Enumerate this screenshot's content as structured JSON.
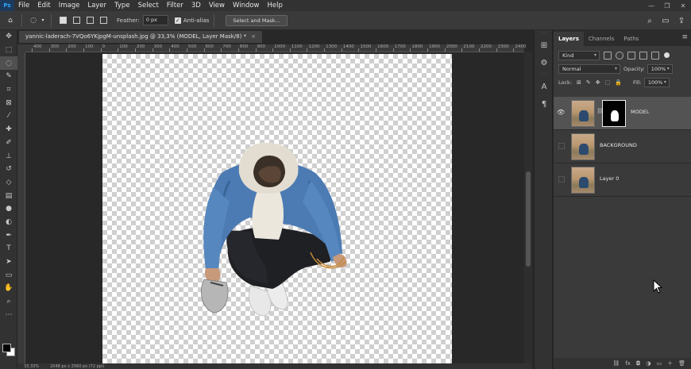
{
  "menubar": {
    "logo": "Ps",
    "items": [
      "File",
      "Edit",
      "Image",
      "Layer",
      "Type",
      "Select",
      "Filter",
      "3D",
      "View",
      "Window",
      "Help"
    ],
    "controls": [
      "—",
      "❐",
      "✕"
    ]
  },
  "options": {
    "feather_label": "Feather:",
    "feather_value": "0 px",
    "antialias_label": "Anti-alias",
    "select_mask_button": "Select and Mask..."
  },
  "document": {
    "tab_title": "yannic-laderach-7VQo6YKjpgM-unsplash.jpg @ 33,3% (MODEL, Layer Mask/8) *",
    "tab_close": "×",
    "ruler_marks": [
      "400",
      "300",
      "200",
      "100",
      "0",
      "100",
      "200",
      "300",
      "400",
      "500",
      "600",
      "700",
      "800",
      "900",
      "1000",
      "1100",
      "1200",
      "1300",
      "1400",
      "1500",
      "1600",
      "1700",
      "1800",
      "1900",
      "2000",
      "2100",
      "2200",
      "2300",
      "2400"
    ]
  },
  "status": {
    "zoom": "33,33%",
    "doc_size": "2048 px x 2560 px (72 ppi)"
  },
  "panel": {
    "tabs": [
      "Layers",
      "Channels",
      "Paths"
    ],
    "menu_icon": "≡",
    "kind_label": "Kind",
    "blend_mode": "Normal",
    "opacity_label": "Opacity:",
    "opacity_value": "100%",
    "lock_label": "Lock:",
    "fill_label": "Fill:",
    "fill_value": "100%",
    "layers": [
      {
        "name": "MODEL"
      },
      {
        "name": "BACKGROUND"
      },
      {
        "name": "Layer 0"
      }
    ],
    "bottom_icons": [
      "⛓",
      "fx",
      "◘",
      "◑",
      "▭",
      "＋",
      "🗑"
    ]
  },
  "tools": [
    "move-icon",
    "marquee-icon",
    "lasso-icon",
    "quick-select-icon",
    "crop-icon",
    "frame-icon",
    "eyedropper-icon",
    "healing-icon",
    "brush-icon",
    "stamp-icon",
    "history-brush-icon",
    "eraser-icon",
    "gradient-icon",
    "blur-icon",
    "dodge-icon",
    "pen-icon",
    "type-icon",
    "path-select-icon",
    "shape-icon",
    "hand-icon",
    "zoom-icon",
    "more-icon"
  ],
  "colors": {
    "accent": "#31a8ff",
    "panel": "#3a3a3a",
    "selected_layer": "#535353"
  }
}
